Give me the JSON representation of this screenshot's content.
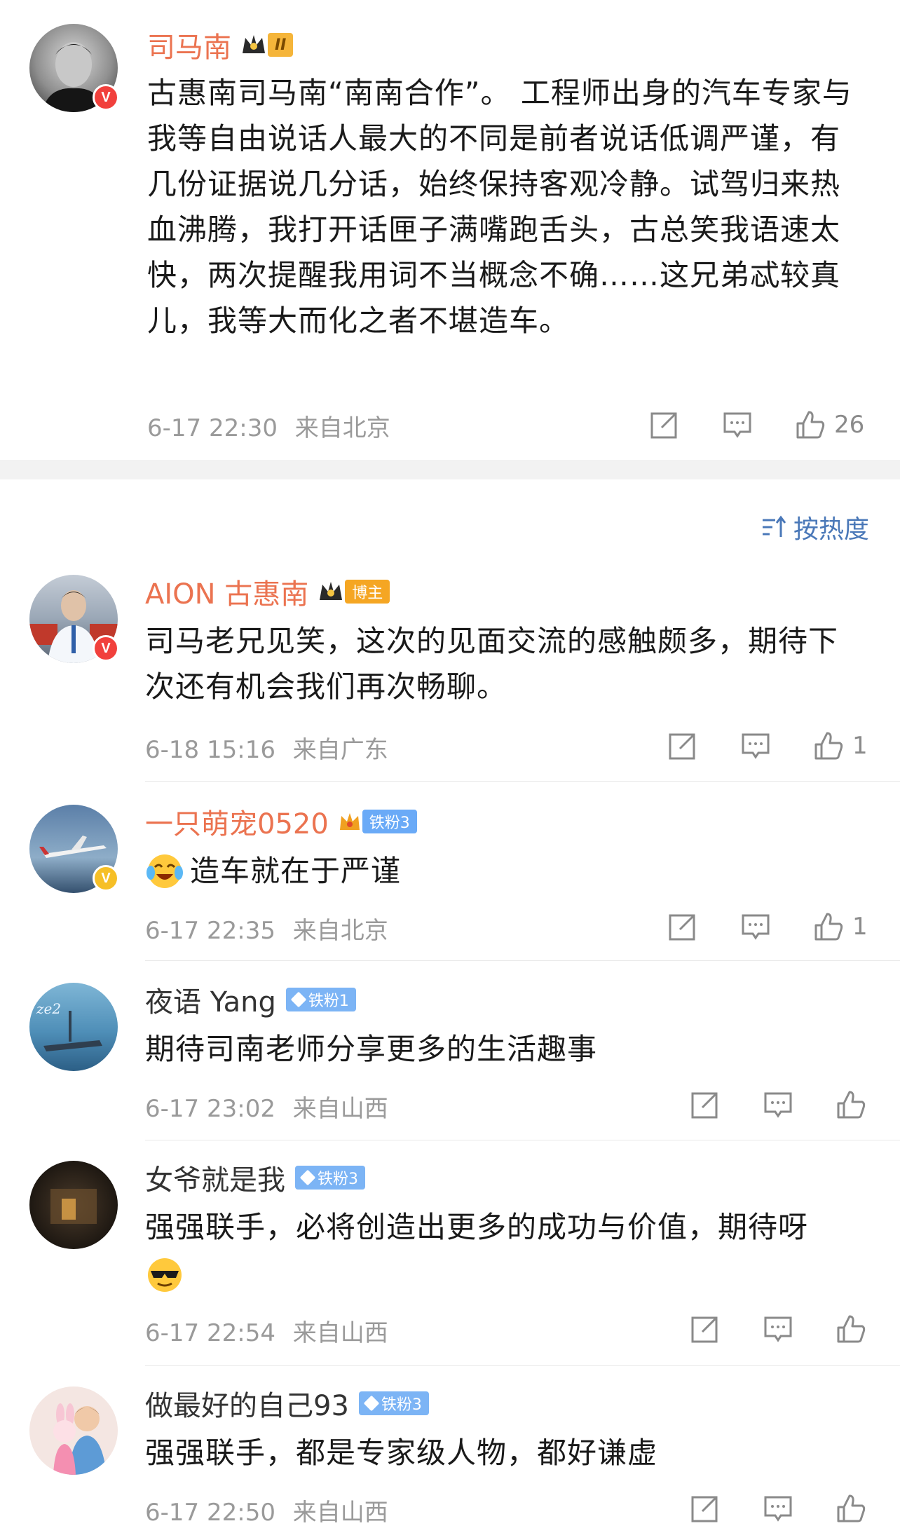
{
  "sort": {
    "label": "按热度"
  },
  "comments": [
    {
      "name": "司马南",
      "badge": "II",
      "content": "古惠南司马南“南南合作”。 工程师出身的汽车专家与我等自由说话人最大的不同是前者说话低调严谨，有几份证据说几分话，始终保持客观冷静。试驾归来热血沸腾，我打开话匣子满嘴跑舌头，古总笑我语速太快，两次提醒我用词不当概念不确……这兄弟忒较真儿，我等大而化之者不堪造车。",
      "time": "6-17 22:30",
      "location": "来自北京",
      "likes": "26"
    },
    {
      "name": "AION 古惠南",
      "badge": "博主",
      "content": "司马老兄见笑，这次的见面交流的感触颇多，期待下次还有机会我们再次畅聊。",
      "time": "6-18 15:16",
      "location": "来自广东",
      "likes": "1"
    },
    {
      "name": "一只萌宠0520",
      "badge": "铁粉3",
      "content": "造车就在于严谨",
      "time": "6-17 22:35",
      "location": "来自北京",
      "likes": "1"
    },
    {
      "name": "夜语 Yang",
      "badge": "铁粉1",
      "content": "期待司南老师分享更多的生活趣事",
      "time": "6-17 23:02",
      "location": "来自山西",
      "likes": ""
    },
    {
      "name": "女爷就是我",
      "badge": "铁粉3",
      "content": "强强联手，必将创造出更多的成功与价值，期待呀",
      "time": "6-17 22:54",
      "location": "来自山西",
      "likes": ""
    },
    {
      "name": "做最好的自己93",
      "badge": "铁粉3",
      "content": "强强联手，都是专家级人物，都好谦虚",
      "time": "6-17 22:50",
      "location": "来自山西",
      "likes": ""
    }
  ]
}
